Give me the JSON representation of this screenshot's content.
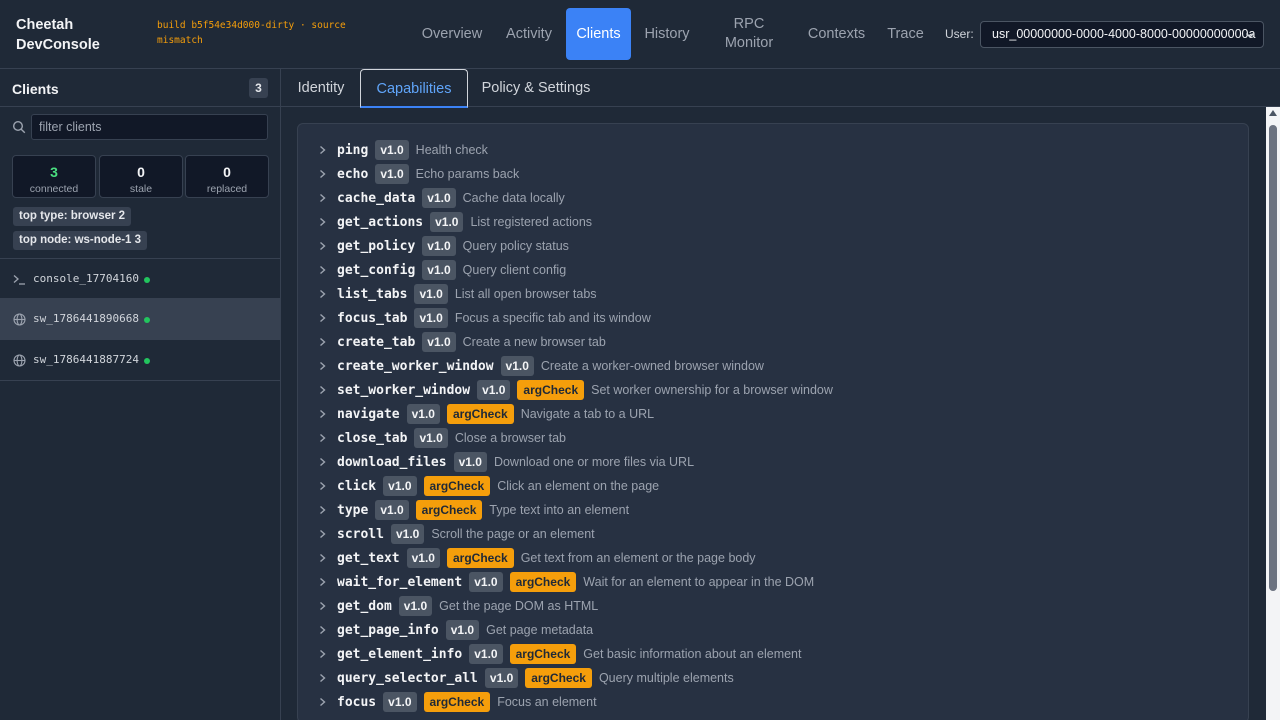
{
  "app": {
    "brand": "Cheetah DevConsole",
    "build_note": "build b5f54e34d000-dirty · source mismatch"
  },
  "nav": {
    "tabs": [
      {
        "label": "Overview"
      },
      {
        "label": "Activity"
      },
      {
        "label": "Clients",
        "active": true
      },
      {
        "label": "History"
      },
      {
        "label": "RPC Monitor"
      },
      {
        "label": "Contexts"
      },
      {
        "label": "Trace"
      }
    ]
  },
  "user": {
    "label": "User:",
    "selected": "usr_00000000-0000-4000-8000-00000000000a"
  },
  "sidebar": {
    "title": "Clients",
    "count": "3",
    "filter_placeholder": "filter clients",
    "filter_value": "",
    "stats": [
      {
        "value": "3",
        "label": "connected"
      },
      {
        "value": "0",
        "label": "stale"
      },
      {
        "value": "0",
        "label": "replaced"
      }
    ],
    "chips": [
      "top type: browser 2",
      "top node: ws-node-1 3"
    ],
    "clients": [
      {
        "name": "console_17704160",
        "kind": "terminal-icon",
        "status": "#22c55e"
      },
      {
        "name": "sw_1786441890668",
        "kind": "globe-icon",
        "status": "#22c55e",
        "selected": true
      },
      {
        "name": "sw_1786441887724",
        "kind": "globe-icon",
        "status": "#22c55e"
      }
    ]
  },
  "detail_tabs": [
    {
      "label": "Identity"
    },
    {
      "label": "Capabilities",
      "active": true
    },
    {
      "label": "Policy & Settings"
    }
  ],
  "capabilities": [
    {
      "name": "ping",
      "version": "v1.0",
      "argcheck": "",
      "desc": "Health check"
    },
    {
      "name": "echo",
      "version": "v1.0",
      "argcheck": "",
      "desc": "Echo params back"
    },
    {
      "name": "cache_data",
      "version": "v1.0",
      "argcheck": "",
      "desc": "Cache data locally"
    },
    {
      "name": "get_actions",
      "version": "v1.0",
      "argcheck": "",
      "desc": "List registered actions"
    },
    {
      "name": "get_policy",
      "version": "v1.0",
      "argcheck": "",
      "desc": "Query policy status"
    },
    {
      "name": "get_config",
      "version": "v1.0",
      "argcheck": "",
      "desc": "Query client config"
    },
    {
      "name": "list_tabs",
      "version": "v1.0",
      "argcheck": "",
      "desc": "List all open browser tabs"
    },
    {
      "name": "focus_tab",
      "version": "v1.0",
      "argcheck": "",
      "desc": "Focus a specific tab and its window"
    },
    {
      "name": "create_tab",
      "version": "v1.0",
      "argcheck": "",
      "desc": "Create a new browser tab"
    },
    {
      "name": "create_worker_window",
      "version": "v1.0",
      "argcheck": "",
      "desc": "Create a worker-owned browser window"
    },
    {
      "name": "set_worker_window",
      "version": "v1.0",
      "argcheck": "argCheck",
      "desc": "Set worker ownership for a browser window"
    },
    {
      "name": "navigate",
      "version": "v1.0",
      "argcheck": "argCheck",
      "desc": "Navigate a tab to a URL"
    },
    {
      "name": "close_tab",
      "version": "v1.0",
      "argcheck": "",
      "desc": "Close a browser tab"
    },
    {
      "name": "download_files",
      "version": "v1.0",
      "argcheck": "",
      "desc": "Download one or more files via URL"
    },
    {
      "name": "click",
      "version": "v1.0",
      "argcheck": "argCheck",
      "desc": "Click an element on the page"
    },
    {
      "name": "type",
      "version": "v1.0",
      "argcheck": "argCheck",
      "desc": "Type text into an element"
    },
    {
      "name": "scroll",
      "version": "v1.0",
      "argcheck": "",
      "desc": "Scroll the page or an element"
    },
    {
      "name": "get_text",
      "version": "v1.0",
      "argcheck": "argCheck",
      "desc": "Get text from an element or the page body"
    },
    {
      "name": "wait_for_element",
      "version": "v1.0",
      "argcheck": "argCheck",
      "desc": "Wait for an element to appear in the DOM"
    },
    {
      "name": "get_dom",
      "version": "v1.0",
      "argcheck": "",
      "desc": "Get the page DOM as HTML"
    },
    {
      "name": "get_page_info",
      "version": "v1.0",
      "argcheck": "",
      "desc": "Get page metadata"
    },
    {
      "name": "get_element_info",
      "version": "v1.0",
      "argcheck": "argCheck",
      "desc": "Get basic information about an element"
    },
    {
      "name": "query_selector_all",
      "version": "v1.0",
      "argcheck": "argCheck",
      "desc": "Query multiple elements"
    },
    {
      "name": "focus",
      "version": "v1.0",
      "argcheck": "argCheck",
      "desc": "Focus an element"
    }
  ],
  "colors": {
    "accent": "#3b82f6",
    "warning": "#f59e0b",
    "online": "#22c55e",
    "background": "#1f2937"
  }
}
